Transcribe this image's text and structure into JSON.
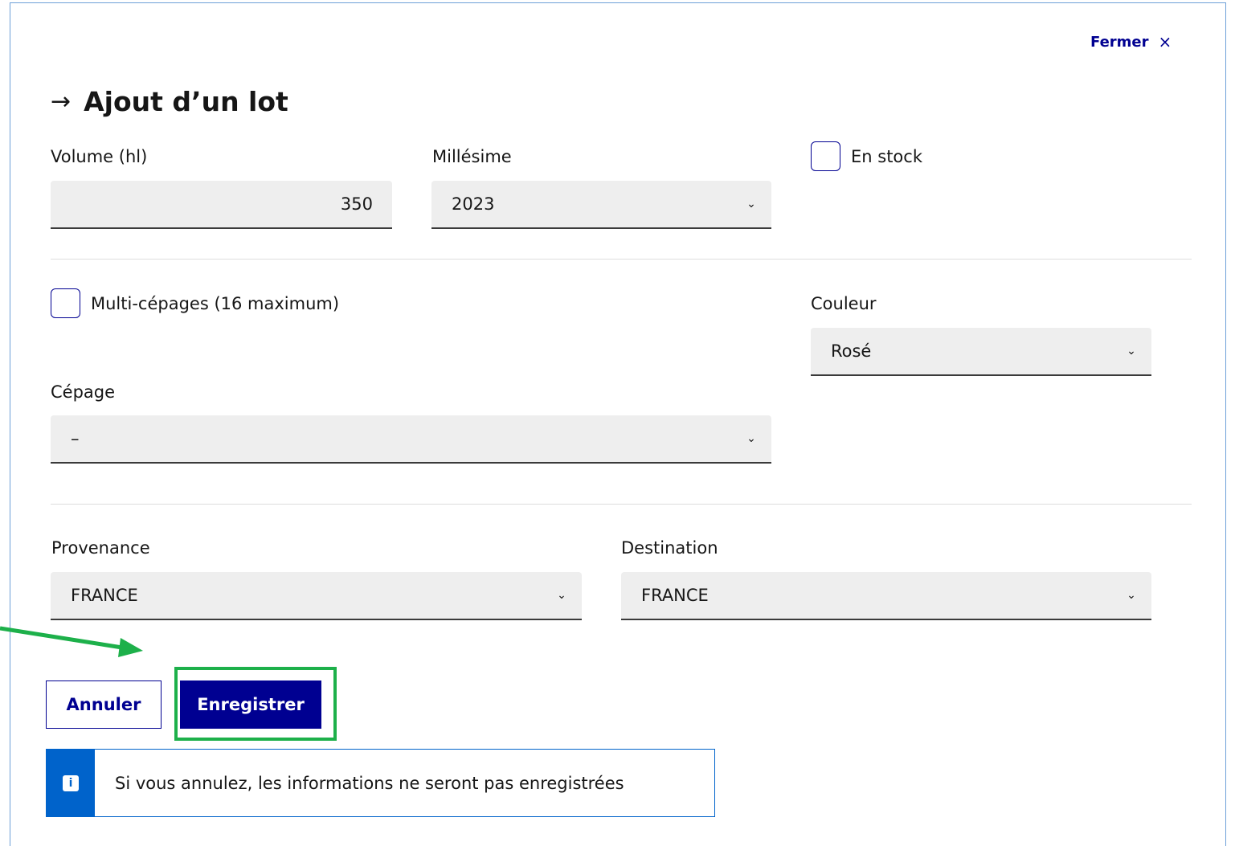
{
  "modal": {
    "close_label": "Fermer",
    "close_icon": "×",
    "title_arrow": "→",
    "title": "Ajout d’un lot"
  },
  "form": {
    "volume_label": "Volume (hl)",
    "volume_value": "350",
    "millesime_label": "Millésime",
    "millesime_value": "2023",
    "en_stock_label": "En stock",
    "en_stock_checked": false,
    "multi_cepages_label": "Multi-cépages (16 maximum)",
    "multi_cepages_checked": false,
    "couleur_label": "Couleur",
    "couleur_value": "Rosé",
    "cepage_label": "Cépage",
    "cepage_value": "–",
    "provenance_label": "Provenance",
    "provenance_value": "FRANCE",
    "destination_label": "Destination",
    "destination_value": "FRANCE",
    "chevron": "⌄"
  },
  "actions": {
    "cancel_label": "Annuler",
    "save_label": "Enregistrer"
  },
  "notice": {
    "icon": "i",
    "message": "Si vous annulez, les informations ne seront pas enregistrées"
  },
  "colors": {
    "primary": "#000091",
    "info": "#0063cb",
    "annotation": "#1db04a",
    "field_bg": "#eeeeee"
  }
}
